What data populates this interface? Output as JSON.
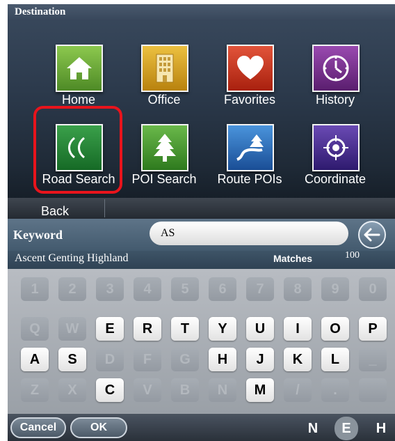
{
  "header": {
    "title": "Destination"
  },
  "tiles": [
    {
      "label": "Home",
      "icon": "home-icon",
      "color": "#6aa33a"
    },
    {
      "label": "Office",
      "icon": "office-building-icon",
      "color": "#d4a21e"
    },
    {
      "label": "Favorites",
      "icon": "heart-icon",
      "color": "#c8321e"
    },
    {
      "label": "History",
      "icon": "clock-icon",
      "color": "#7a2e8c"
    },
    {
      "label": "Road Search",
      "icon": "road-icon",
      "color": "#2e8a3a"
    },
    {
      "label": "POI Search",
      "icon": "tree-icon",
      "color": "#4a9a36"
    },
    {
      "label": "Route POIs",
      "icon": "route-icon",
      "color": "#2a6cb4"
    },
    {
      "label": "Coordinate",
      "icon": "crosshair-icon",
      "color": "#4a2e8c"
    }
  ],
  "selected_tile": "Road Search",
  "back_label": "Back",
  "search": {
    "label": "Keyword",
    "value": "AS"
  },
  "result": {
    "text": "Ascent Genting Highland",
    "matches_label": "Matches",
    "matches_count": "100"
  },
  "keyboard": {
    "rows": [
      [
        {
          "k": "1",
          "on": false
        },
        {
          "k": "2",
          "on": false
        },
        {
          "k": "3",
          "on": false
        },
        {
          "k": "4",
          "on": false
        },
        {
          "k": "5",
          "on": false
        },
        {
          "k": "6",
          "on": false
        },
        {
          "k": "7",
          "on": false
        },
        {
          "k": "8",
          "on": false
        },
        {
          "k": "9",
          "on": false
        },
        {
          "k": "0",
          "on": false
        }
      ],
      [
        {
          "k": "Q",
          "on": false
        },
        {
          "k": "W",
          "on": false
        },
        {
          "k": "E",
          "on": true
        },
        {
          "k": "R",
          "on": true
        },
        {
          "k": "T",
          "on": true
        },
        {
          "k": "Y",
          "on": true
        },
        {
          "k": "U",
          "on": true
        },
        {
          "k": "I",
          "on": true
        },
        {
          "k": "O",
          "on": true
        },
        {
          "k": "P",
          "on": true
        }
      ],
      [
        {
          "k": "A",
          "on": true
        },
        {
          "k": "S",
          "on": true
        },
        {
          "k": "D",
          "on": false
        },
        {
          "k": "F",
          "on": false
        },
        {
          "k": "G",
          "on": false
        },
        {
          "k": "H",
          "on": true
        },
        {
          "k": "J",
          "on": true
        },
        {
          "k": "K",
          "on": true
        },
        {
          "k": "L",
          "on": true
        },
        {
          "k": "_",
          "on": false
        }
      ],
      [
        {
          "k": "Z",
          "on": false
        },
        {
          "k": "X",
          "on": false
        },
        {
          "k": "C",
          "on": true
        },
        {
          "k": "V",
          "on": false
        },
        {
          "k": "B",
          "on": false
        },
        {
          "k": "N",
          "on": false
        },
        {
          "k": "M",
          "on": true
        },
        {
          "k": "/",
          "on": false
        },
        {
          "k": ".",
          "on": false
        },
        {
          "k": "",
          "on": false
        }
      ]
    ]
  },
  "buttons": {
    "cancel": "Cancel",
    "ok": "OK"
  },
  "language_modes": [
    {
      "label": "N",
      "selected": false
    },
    {
      "label": "E",
      "selected": true
    },
    {
      "label": "H",
      "selected": false
    }
  ]
}
